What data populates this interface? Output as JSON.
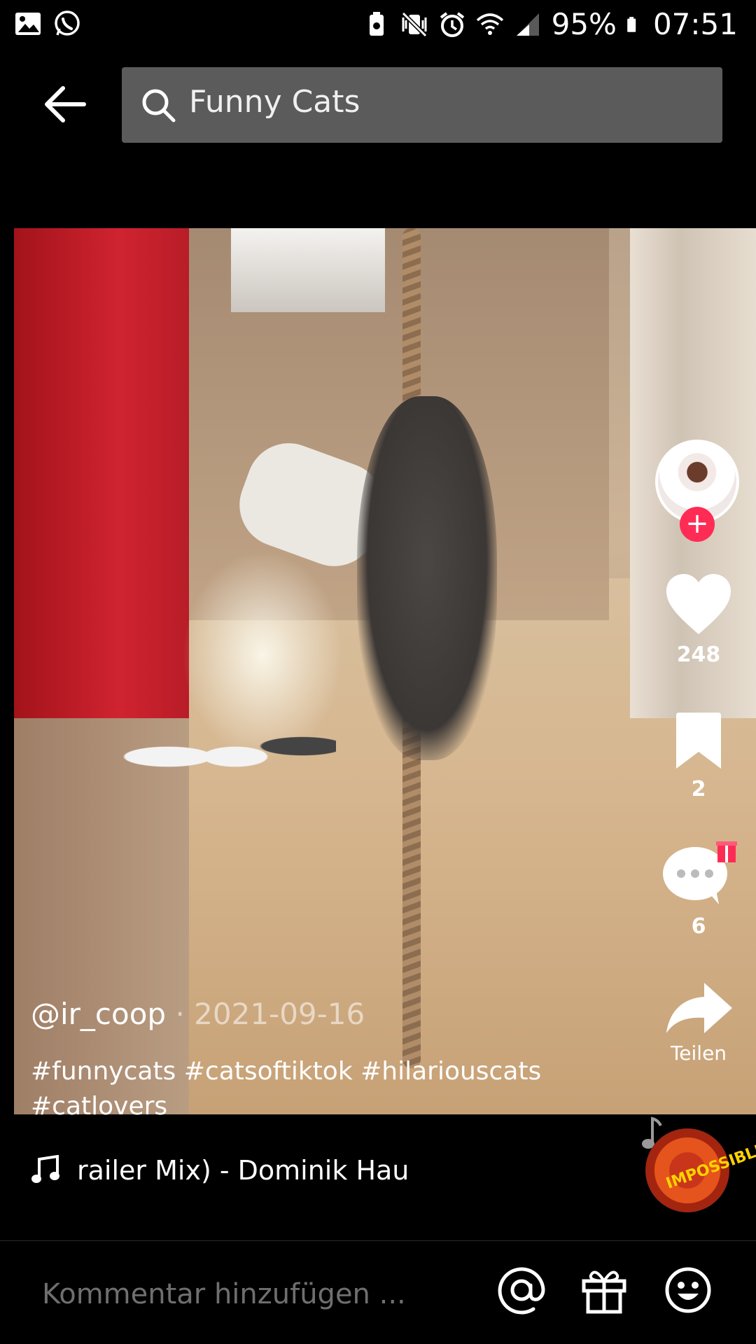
{
  "status_bar": {
    "battery": "95%",
    "time": "07:51",
    "icons": [
      "gallery-icon",
      "whatsapp-icon",
      "battery-saver-icon",
      "vibrate-mute-icon",
      "alarm-icon",
      "wifi-icon",
      "signal-icon",
      "battery-icon"
    ]
  },
  "search": {
    "query": "Funny Cats",
    "back_icon": "arrow-left-icon",
    "search_icon": "search-icon"
  },
  "post": {
    "username": "@ir_coop",
    "date": "· 2021-09-16",
    "hashtags": "#funnycats #catsoftiktok #hilariouscats #catlovers"
  },
  "actions": {
    "likes": "248",
    "saves": "2",
    "comments": "6",
    "share_label": "Teilen"
  },
  "music": {
    "title": "railer Mix) - Dominik Hause",
    "disc_label": "IMPOSSIBLE"
  },
  "comment_bar": {
    "placeholder": "Kommentar hinzufügen ...",
    "icons": [
      "at-icon",
      "gift-icon",
      "emoji-icon"
    ]
  },
  "colors": {
    "accent": "#fe2c55",
    "search_bg": "#5b5b5b",
    "background": "#000000"
  }
}
